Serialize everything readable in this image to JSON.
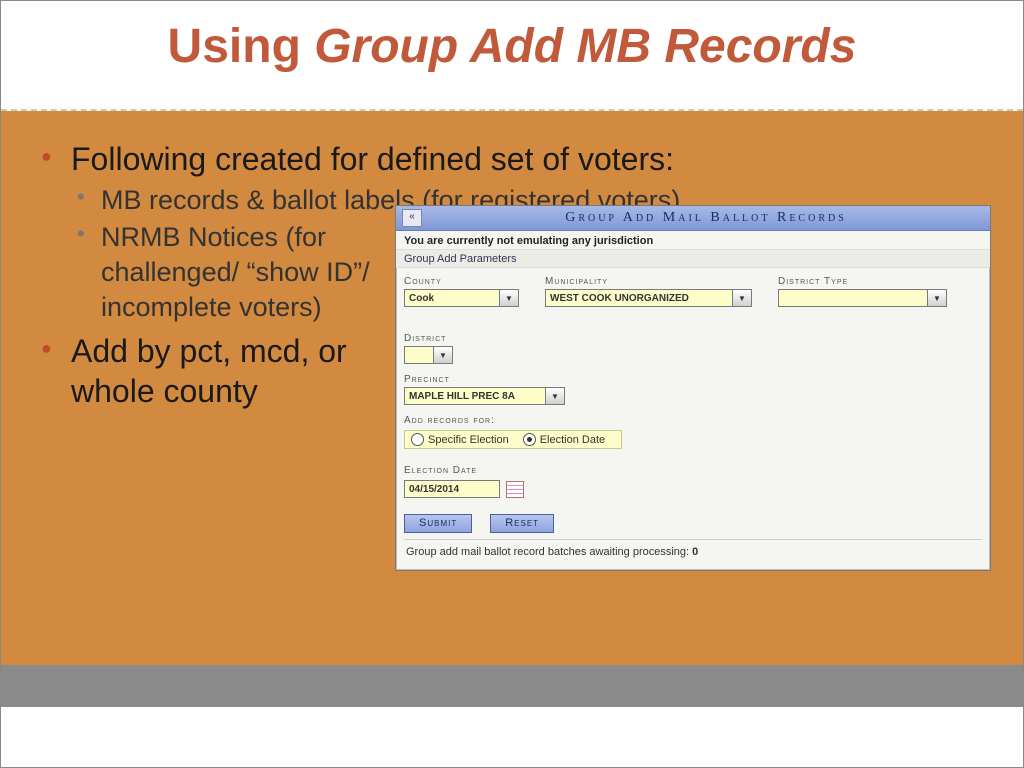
{
  "header": {
    "t1": "Using ",
    "t2": "Group Add MB Records"
  },
  "bullets": {
    "b1": "Following created for defined set of voters:",
    "s1": "MB records & ballot labels (for registered voters)",
    "s2": "NRMB Notices (for challenged/ “show ID”/ incomplete voters)",
    "b2": "Add by pct, mcd, or whole county"
  },
  "app": {
    "back_glyph": "«",
    "title": "Group Add Mail Ballot Records",
    "emulate_msg": "You are currently not emulating any jurisdiction",
    "section": "Group Add Parameters",
    "labels": {
      "county": "County",
      "municipality": "Municipality",
      "district_type": "District Type",
      "district": "District",
      "precinct": "Precinct",
      "add_for": "Add records for:",
      "election_date": "Election Date"
    },
    "values": {
      "county": "Cook",
      "municipality": "WEST COOK UNORGANIZED",
      "district_type": "",
      "district": "",
      "precinct": "MAPLE HILL PREC 8A",
      "election_date": "04/15/2014"
    },
    "radios": {
      "specific": "Specific Election",
      "date": "Election Date"
    },
    "buttons": {
      "submit": "Submit",
      "reset": "Reset"
    },
    "status_text": "Group add mail ballot record batches awaiting processing:  ",
    "status_count": "0",
    "chevron": "▼"
  }
}
